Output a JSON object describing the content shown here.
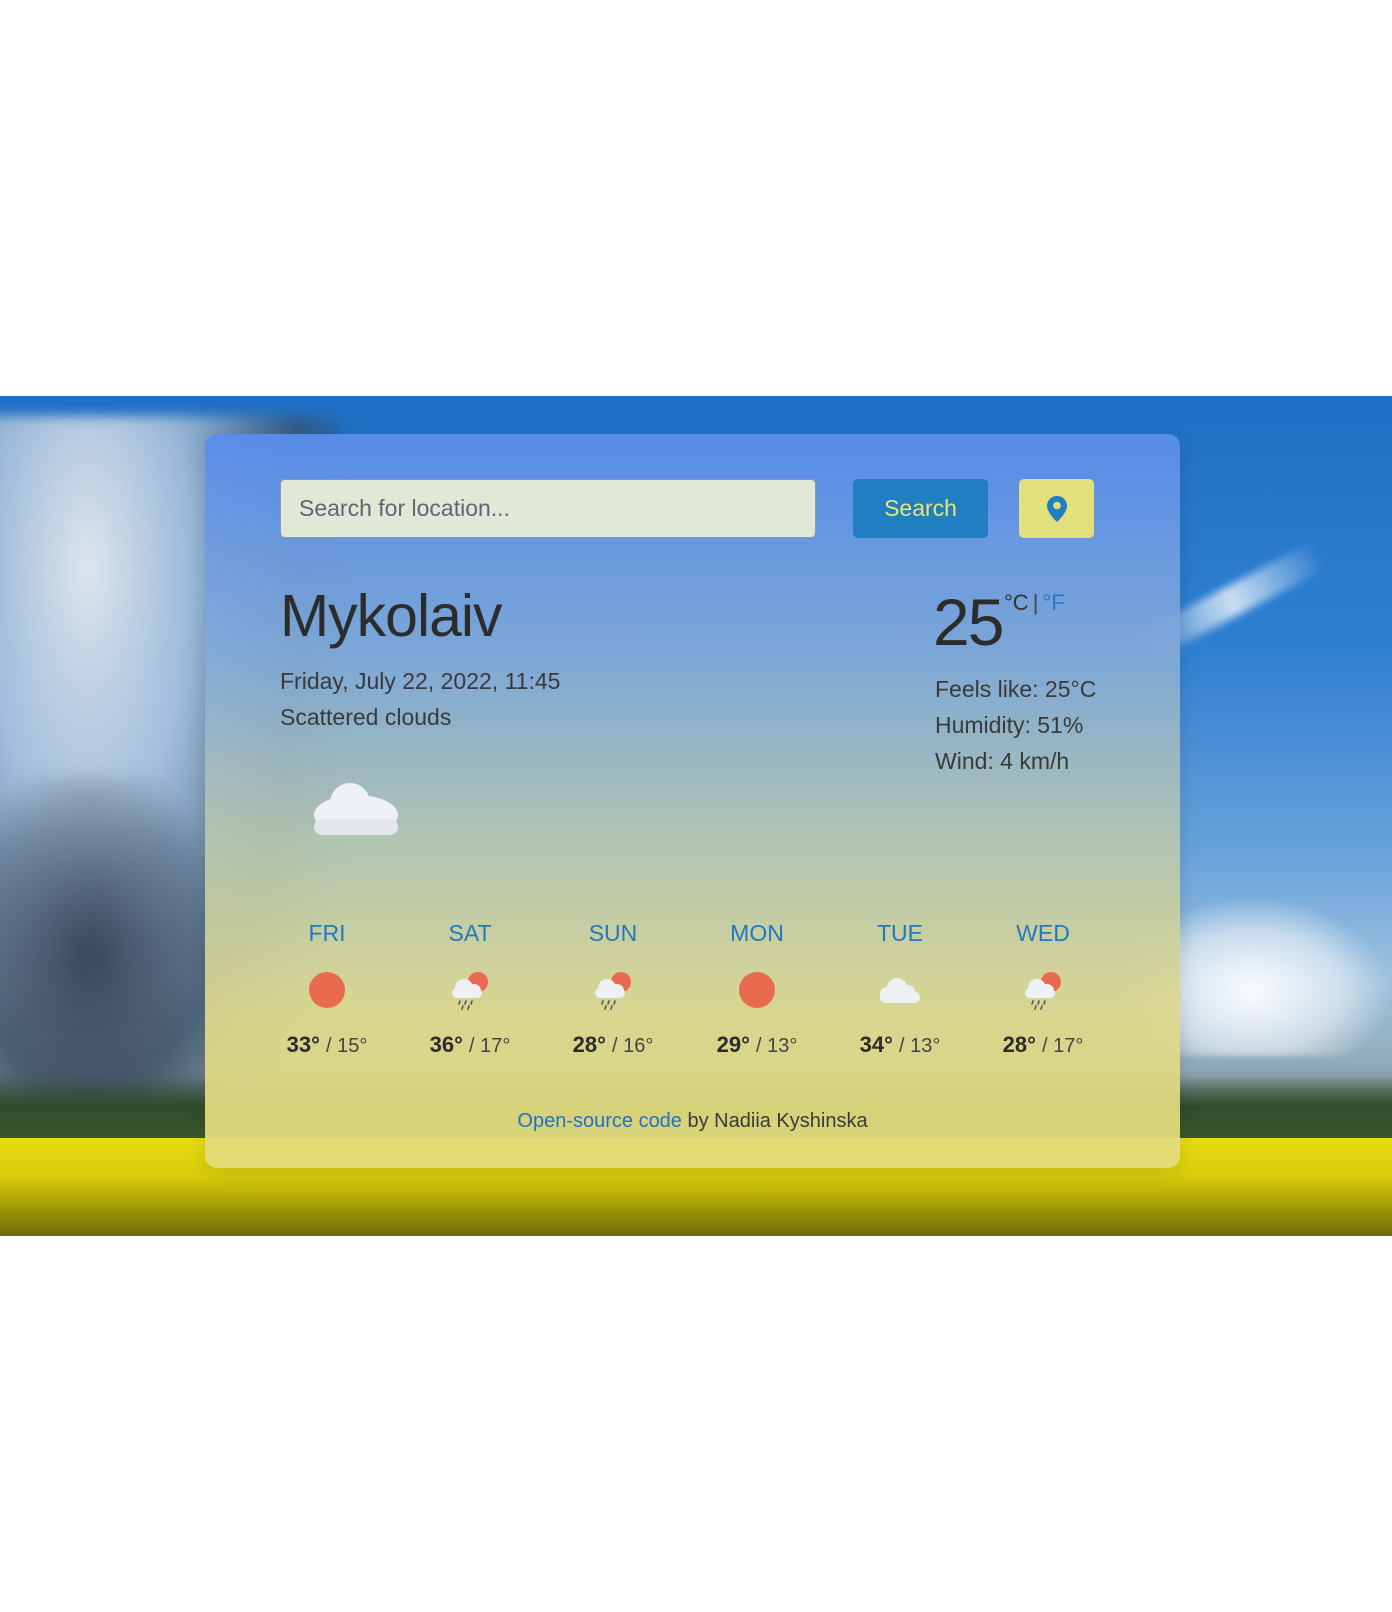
{
  "search": {
    "placeholder": "Search for location...",
    "button_label": "Search"
  },
  "location_button": {
    "icon": "map-pin-icon"
  },
  "current": {
    "city": "Mykolaiv",
    "datetime": "Friday, July 22, 2022, 11:45",
    "condition": "Scattered clouds",
    "icon": "cloud-icon",
    "temperature": "25",
    "unit_c": "°C",
    "unit_separator": "|",
    "unit_f": "°F",
    "feels_like": "Feels like: 25°C",
    "humidity": "Humidity: 51%",
    "wind": "Wind: 4 km/h"
  },
  "forecast": [
    {
      "day": "FRI",
      "icon": "sun-icon",
      "max": "33°",
      "min": "/ 15°"
    },
    {
      "day": "SAT",
      "icon": "rain-sun-icon",
      "max": "36°",
      "min": "/ 17°"
    },
    {
      "day": "SUN",
      "icon": "rain-sun-icon",
      "max": "28°",
      "min": "/ 16°"
    },
    {
      "day": "MON",
      "icon": "sun-icon",
      "max": "29°",
      "min": "/ 13°"
    },
    {
      "day": "TUE",
      "icon": "cloud-icon",
      "max": "34°",
      "min": "/ 13°"
    },
    {
      "day": "WED",
      "icon": "rain-sun-icon",
      "max": "28°",
      "min": "/ 17°"
    }
  ],
  "footer": {
    "link_text": "Open-source code",
    "text": "by Nadiia Kyshinska"
  },
  "colors": {
    "accent": "#1f7fc0",
    "accent_text": "#e8e37a",
    "sun": "#e86a4f",
    "link": "#1f72c8"
  }
}
